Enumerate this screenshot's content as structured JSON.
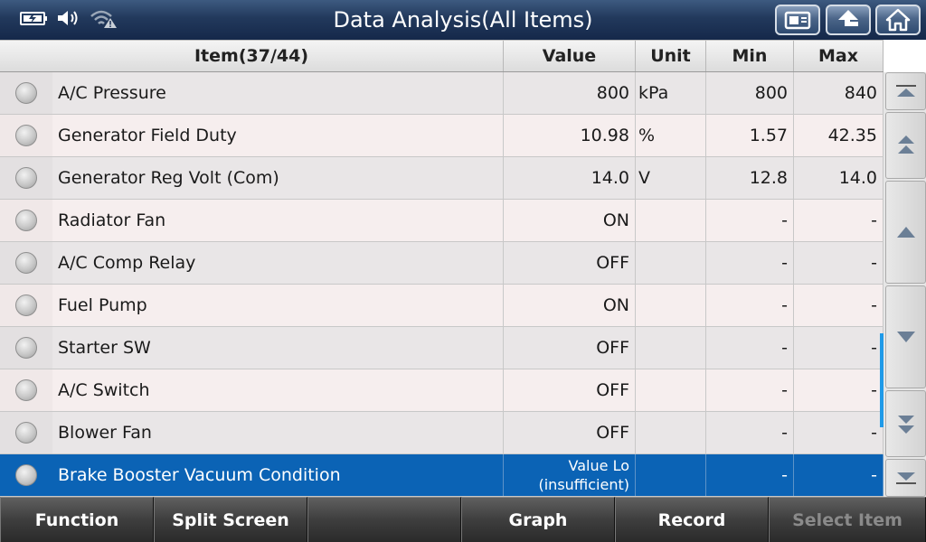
{
  "titlebar": {
    "title": "Data Analysis(All Items)",
    "status_icons": [
      "battery-icon",
      "speaker-icon",
      "wifi-warning-icon"
    ],
    "buttons": [
      "screenshot-icon",
      "back-arrow-icon",
      "home-icon"
    ]
  },
  "table": {
    "headers": {
      "item": "Item(37/44)",
      "value": "Value",
      "unit": "Unit",
      "min": "Min",
      "max": "Max"
    },
    "rows": [
      {
        "item": "A/C Pressure",
        "value": "800",
        "unit": "kPa",
        "min": "800",
        "max": "840"
      },
      {
        "item": "Generator Field Duty",
        "value": "10.98",
        "unit": "%",
        "min": "1.57",
        "max": "42.35"
      },
      {
        "item": "Generator Reg Volt (Com)",
        "value": "14.0",
        "unit": "V",
        "min": "12.8",
        "max": "14.0"
      },
      {
        "item": "Radiator Fan",
        "value": "ON",
        "unit": "",
        "min": "-",
        "max": "-"
      },
      {
        "item": "A/C Comp Relay",
        "value": "OFF",
        "unit": "",
        "min": "-",
        "max": "-"
      },
      {
        "item": "Fuel Pump",
        "value": "ON",
        "unit": "",
        "min": "-",
        "max": "-"
      },
      {
        "item": "Starter SW",
        "value": "OFF",
        "unit": "",
        "min": "-",
        "max": "-"
      },
      {
        "item": "A/C Switch",
        "value": "OFF",
        "unit": "",
        "min": "-",
        "max": "-"
      },
      {
        "item": "Blower Fan",
        "value": "OFF",
        "unit": "",
        "min": "-",
        "max": "-"
      },
      {
        "item": "Brake Booster Vacuum Condition",
        "value_line1": "Value Lo",
        "value_line2": "(insufficient)",
        "unit": "",
        "min": "-",
        "max": "-",
        "selected": true
      }
    ]
  },
  "scroll_buttons": [
    "scroll-top-icon",
    "page-up-icon",
    "line-up-icon",
    "line-down-icon",
    "page-down-icon",
    "scroll-bottom-icon"
  ],
  "bottombar": {
    "function": "Function",
    "split_screen": "Split Screen",
    "empty": "",
    "graph": "Graph",
    "record": "Record",
    "select_item": "Select Item"
  },
  "colors": {
    "selected_row": "#0b63b5",
    "scroll_indicator": "#1f9ae8",
    "disabled_text": "#8a8a8a"
  }
}
